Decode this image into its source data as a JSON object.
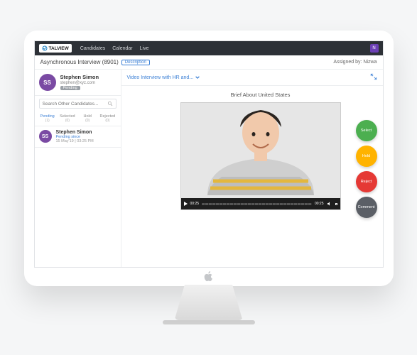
{
  "header": {
    "brand": "TALVIEW",
    "nav": {
      "candidates": "Candidates",
      "calendar": "Calendar",
      "live": "Live"
    },
    "user_initial": "N"
  },
  "subheader": {
    "title": "Asynchronous Interview (8901)",
    "tag": "Description",
    "assigned": "Assigned by: Nizwa"
  },
  "sidebar": {
    "candidate": {
      "initials": "SS",
      "name": "Stephen Simon",
      "email": "stephen@xyz.com",
      "status": "Pending"
    },
    "search": {
      "placeholder": "Search Other Candidates..."
    },
    "filters": [
      {
        "label": "Pending",
        "count": "(1)"
      },
      {
        "label": "Selected",
        "count": "(0)"
      },
      {
        "label": "Hold",
        "count": "(0)"
      },
      {
        "label": "Rejected",
        "count": "(0)"
      }
    ],
    "list": [
      {
        "initials": "SS",
        "name": "Stephen Simon",
        "status": "Pending since",
        "time": "15 May'19 | 03:25 PM"
      }
    ]
  },
  "main": {
    "dropdown": "Video Interview with HR and...",
    "brief": "Brief About United States",
    "player": {
      "time_current": "00:25",
      "time_total": "00:25"
    },
    "actions": {
      "select": "Select",
      "hold": "Hold",
      "reject": "Reject",
      "comment": "Comment"
    }
  }
}
